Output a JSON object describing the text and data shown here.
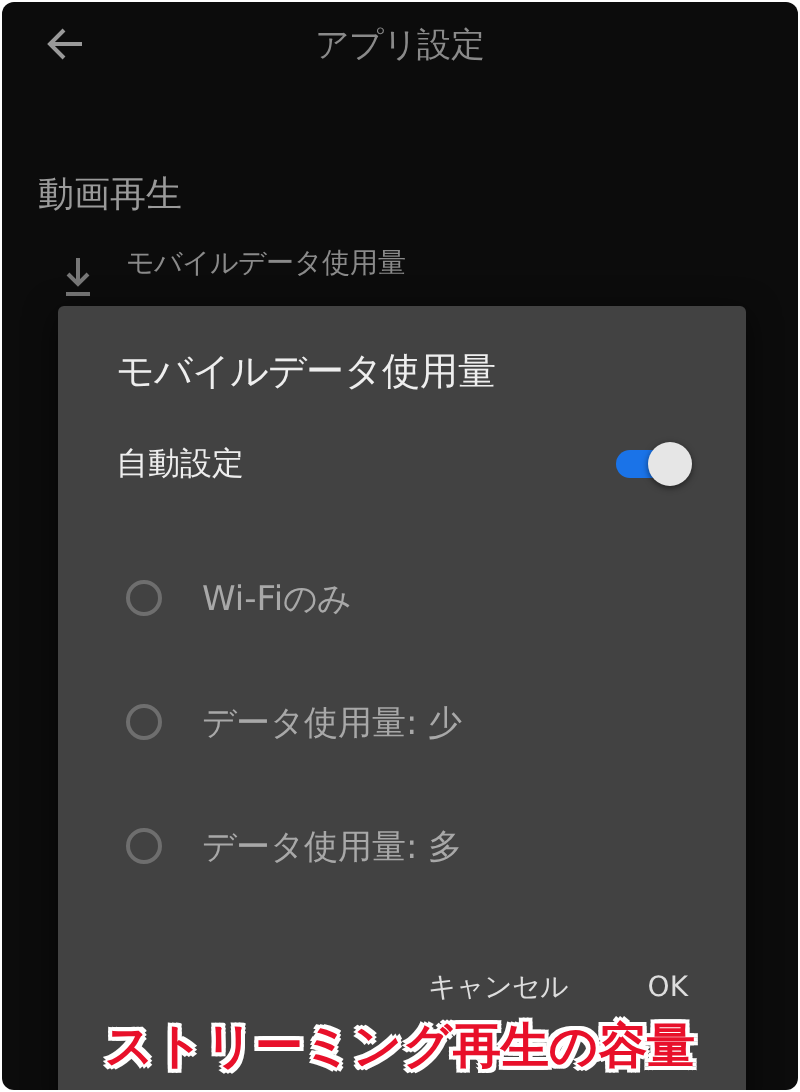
{
  "header": {
    "title": "アプリ設定"
  },
  "section": {
    "title": "動画再生"
  },
  "settings": [
    {
      "label": "モバイルデータ使用量"
    }
  ],
  "dialog": {
    "title": "モバイルデータ使用量",
    "auto": {
      "label": "自動設定",
      "on": true
    },
    "options": [
      {
        "label": "Wi-Fiのみ",
        "selected": false,
        "disabled": true
      },
      {
        "label": "データ使用量: 少",
        "selected": false,
        "disabled": true
      },
      {
        "label": "データ使用量: 多",
        "selected": false,
        "disabled": true
      }
    ],
    "buttons": [
      {
        "label": "キャンセル"
      },
      {
        "label": "OK"
      }
    ]
  },
  "caption": "ストリーミング再生の容量"
}
